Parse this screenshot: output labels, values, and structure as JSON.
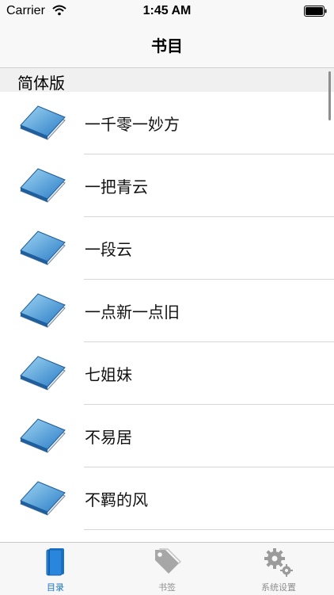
{
  "status_bar": {
    "carrier": "Carrier",
    "time": "1:45 AM",
    "icons": [
      "wifi-icon",
      "battery-icon"
    ]
  },
  "nav": {
    "title": "书目"
  },
  "section": {
    "title": "简体版"
  },
  "books": [
    {
      "title": "一千零一妙方",
      "icon": "book-icon"
    },
    {
      "title": "一把青云",
      "icon": "book-icon"
    },
    {
      "title": "一段云",
      "icon": "book-icon"
    },
    {
      "title": "一点新一点旧",
      "icon": "book-icon"
    },
    {
      "title": "七姐妹",
      "icon": "book-icon"
    },
    {
      "title": "不易居",
      "icon": "book-icon"
    },
    {
      "title": "不羁的风",
      "icon": "book-icon"
    }
  ],
  "tabs": [
    {
      "label": "目录",
      "icon": "book-tab-icon",
      "active": true
    },
    {
      "label": "书签",
      "icon": "tag-icon",
      "active": false
    },
    {
      "label": "系统设置",
      "icon": "gear-icon",
      "active": false
    }
  ],
  "colors": {
    "accent": "#1a73c8",
    "inactive": "#8e8e8e"
  }
}
